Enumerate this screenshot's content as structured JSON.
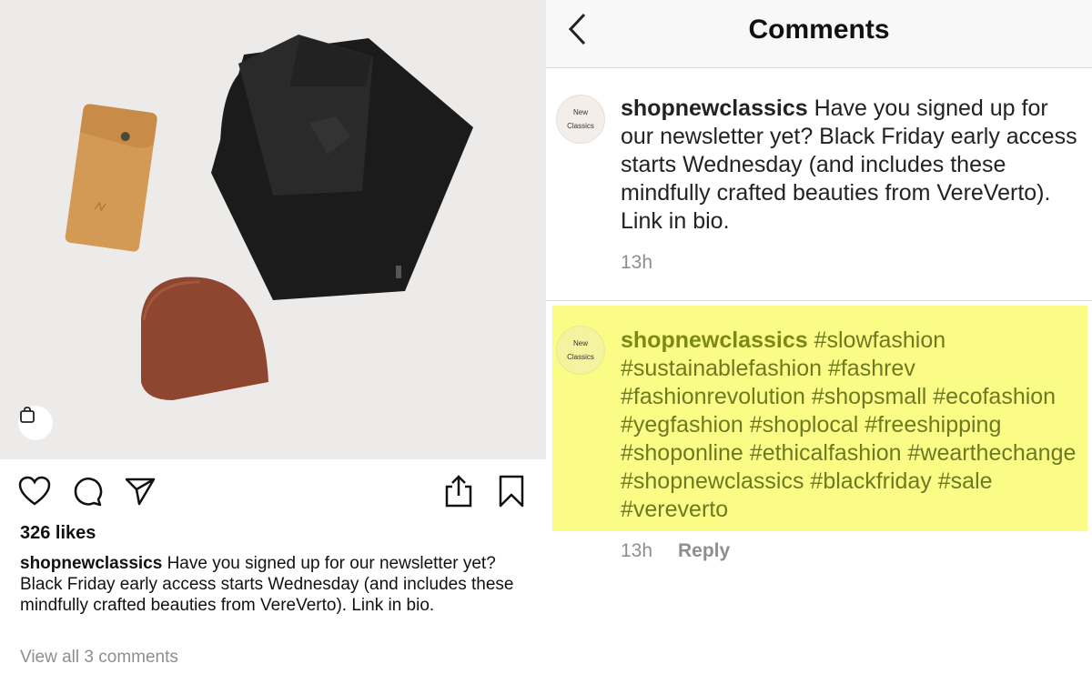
{
  "post": {
    "likes": "326 likes",
    "caption_user": "shopnewclassics",
    "caption_text": " Have you signed up for our newsletter yet? Black Friday early access starts Wednesday (and includes these mindfully crafted beauties from VereVerto). Link in bio.",
    "view_all": "View all 3 comments",
    "actions": [
      "heart-icon",
      "comment-icon",
      "share-icon",
      "upload-icon",
      "bookmark-icon"
    ],
    "shop_icon": "shopping-bag-icon"
  },
  "comments_screen": {
    "title": "Comments",
    "back_icon": "chevron-left-icon",
    "comments": [
      {
        "avatar_line1": "New",
        "avatar_line2": "Classics",
        "user": "shopnewclassics",
        "text": " Have you signed up for our newsletter yet? Black Friday early access starts Wednesday (and includes these mindfully crafted beauties from VereVerto). Link in bio.",
        "time": "13h"
      },
      {
        "avatar_line1": "New",
        "avatar_line2": "Classics",
        "user": "shopnewclassics",
        "text": " #slowfashion #sustainablefashion #fashrev #fashionrevolution #shopsmall #ecofashion #yegfashion #shoplocal #freeshipping #shoponline #ethicalfashion #wearthechange #shopnewclassics #blackfriday #sale #vereverto",
        "time": "13h",
        "reply": "Reply",
        "highlight_color": "#fbfc86"
      }
    ]
  }
}
